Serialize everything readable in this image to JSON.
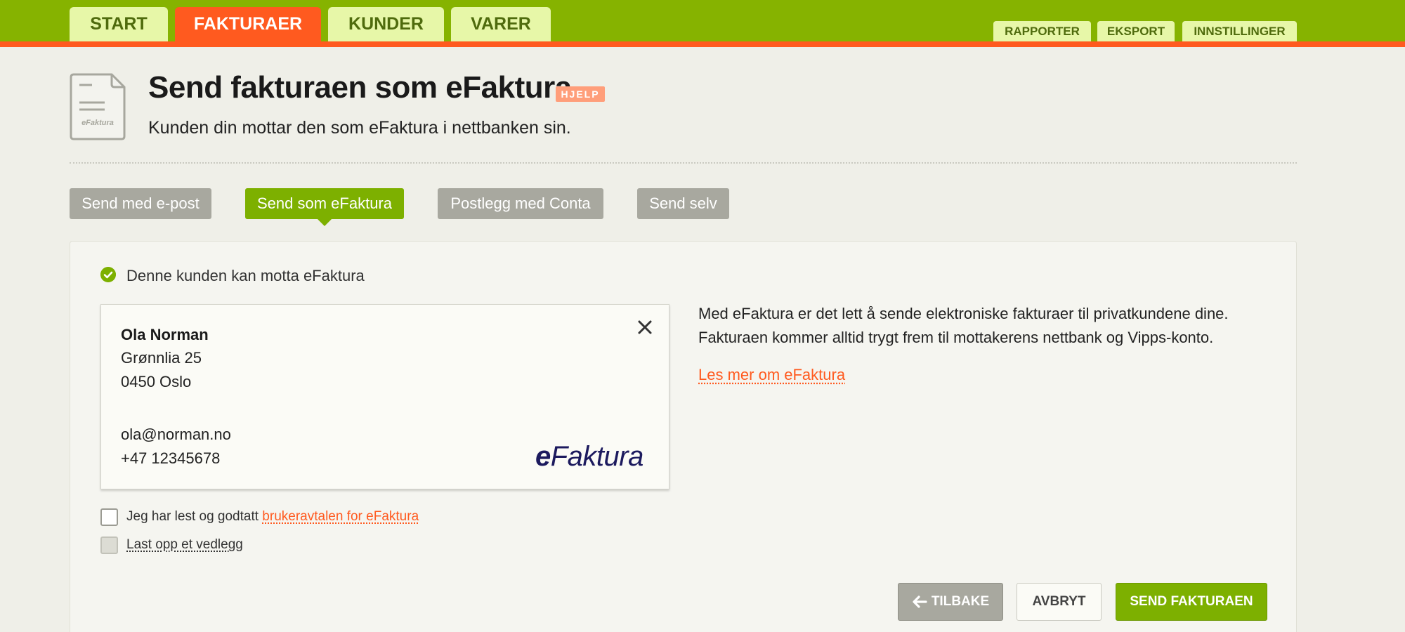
{
  "nav": {
    "main_tabs": [
      {
        "label": "START"
      },
      {
        "label": "FAKTURAER"
      },
      {
        "label": "KUNDER"
      },
      {
        "label": "VARER"
      }
    ],
    "active_tab": "FAKTURAER",
    "secondary_tabs": [
      {
        "label": "RAPPORTER"
      },
      {
        "label": "EKSPORT"
      },
      {
        "label": "INNSTILLINGER"
      }
    ]
  },
  "header": {
    "icon_label": "eFaktura",
    "title": "Send fakturaen som eFaktura",
    "help_label": "HJELP",
    "subtitle": "Kunden din mottar den som eFaktura i nettbanken sin."
  },
  "methods": [
    {
      "label": "Send med e-post"
    },
    {
      "label": "Send som eFaktura"
    },
    {
      "label": "Postlegg med Conta"
    },
    {
      "label": "Send selv"
    }
  ],
  "active_method": "Send som eFaktura",
  "status": {
    "text": "Denne kunden kan motta eFaktura"
  },
  "customer": {
    "name": "Ola Norman",
    "street": "Grønnlia 25",
    "postal": "0450 Oslo",
    "email": "ola@norman.no",
    "phone": "+47 12345678",
    "logo_e": "e",
    "logo_rest": "Faktura"
  },
  "info": {
    "line1": "Med eFaktura er det lett å sende elektroniske fakturaer til privatkundene dine.",
    "line2": "Fakturaen kommer alltid trygt frem til mottakerens nettbank og Vipps-konto.",
    "read_more": "Les mer om eFaktura"
  },
  "agreement": {
    "prefix": "Jeg har lest og godtatt ",
    "link": "brukeravtalen for eFaktura",
    "checked": false
  },
  "attachment": {
    "label": "Last opp et vedlegg"
  },
  "buttons": {
    "back": "TILBAKE",
    "cancel": "AVBRYT",
    "send": "SEND FAKTURAEN"
  },
  "colors": {
    "nav_green": "#86b300",
    "accent_orange": "#ff5a1f",
    "active_green": "#7db000",
    "inactive_gray": "#a8a89f",
    "logo_navy": "#1c1a5e"
  }
}
